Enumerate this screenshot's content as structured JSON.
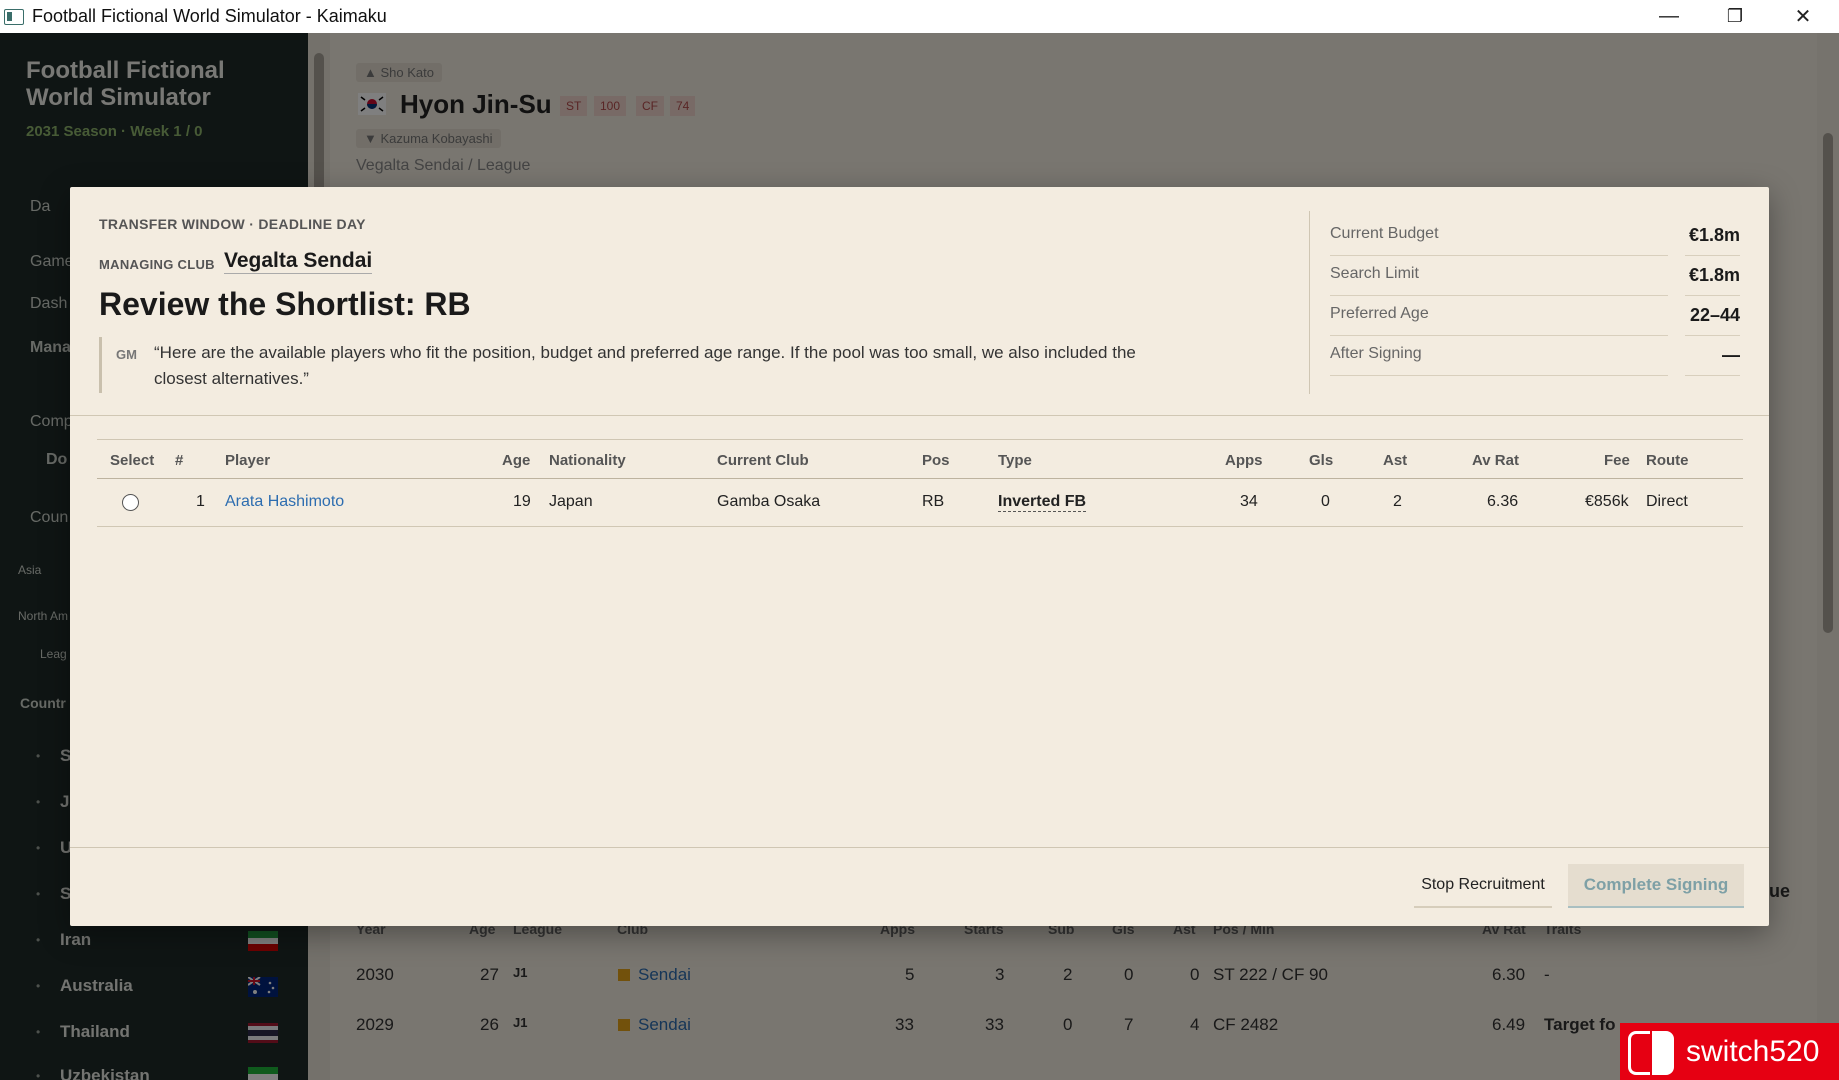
{
  "window": {
    "title": "Football Fictional World Simulator - Kaimaku",
    "minimize": "—",
    "restore": "❐",
    "close": "✕"
  },
  "sidebar": {
    "app_title": "Football Fictional World Simulator",
    "season": "2031 Season · Week 1 / 0",
    "items": [
      "Da",
      "Game",
      "Dash",
      "Mana",
      "Comp",
      "Do",
      "Coun",
      "Asia",
      "North Am",
      "Leag",
      "Countr"
    ],
    "countries": [
      "S",
      "J",
      "U",
      "S",
      "Iran",
      "Australia",
      "Thailand",
      "Uzbekistan"
    ]
  },
  "background": {
    "prev_player": "▲ Sho Kato",
    "player_name": "Hyon Jin-Su",
    "badges": [
      "ST",
      "100",
      "CF",
      "74"
    ],
    "next_player": "▼ Kazuma Kobayashi",
    "subtitle": "Vegalta Sendai / League",
    "right_fragment": "gue",
    "history_headers": [
      "Year",
      "Age",
      "League",
      "Club",
      "Apps",
      "Starts",
      "Sub",
      "Gls",
      "Ast",
      "Pos / Min",
      "Av Rat",
      "Traits"
    ],
    "history_rows": [
      {
        "year": "2030",
        "age": "27",
        "league": "J1",
        "club": "Sendai",
        "apps": "5",
        "starts": "3",
        "sub": "2",
        "gls": "0",
        "ast": "0",
        "pos": "ST 222 / CF 90",
        "avrat": "6.30",
        "traits": "-"
      },
      {
        "year": "2029",
        "age": "26",
        "league": "J1",
        "club": "Sendai",
        "apps": "33",
        "starts": "33",
        "sub": "0",
        "gls": "7",
        "ast": "4",
        "pos": "CF 2482",
        "avrat": "6.49",
        "traits": "Target fo"
      }
    ]
  },
  "modal": {
    "eyebrow": "TRANSFER WINDOW · DEADLINE DAY",
    "club_label": "MANAGING CLUB",
    "club_name": "Vegalta Sendai",
    "heading": "Review the Shortlist: RB",
    "quote_tag": "GM",
    "quote_text": "“Here are the available players who fit the position, budget and preferred age range. If the pool was too small, we also included the closest alternatives.”",
    "stats": [
      {
        "label": "Current Budget",
        "value": "€1.8m"
      },
      {
        "label": "Search Limit",
        "value": "€1.8m"
      },
      {
        "label": "Preferred Age",
        "value": "22–44"
      },
      {
        "label": "After Signing",
        "value": "—"
      }
    ],
    "table": {
      "headers": {
        "select": "Select",
        "num": "#",
        "player": "Player",
        "age": "Age",
        "nationality": "Nationality",
        "club": "Current Club",
        "pos": "Pos",
        "type": "Type",
        "apps": "Apps",
        "gls": "Gls",
        "ast": "Ast",
        "avrat": "Av Rat",
        "fee": "Fee",
        "route": "Route"
      },
      "rows": [
        {
          "num": "1",
          "player": "Arata Hashimoto",
          "age": "19",
          "nationality": "Japan",
          "club": "Gamba Osaka",
          "pos": "RB",
          "type": "Inverted FB",
          "apps": "34",
          "gls": "0",
          "ast": "2",
          "avrat": "6.36",
          "fee": "€856k",
          "route": "Direct"
        }
      ]
    },
    "buttons": {
      "stop": "Stop Recruitment",
      "complete": "Complete Signing"
    }
  },
  "watermark": {
    "text": "switch520"
  },
  "colors": {
    "modal_bg": "#f3ece0",
    "sidebar_bg": "#1f2a28",
    "link": "#2d6db0",
    "complete_text": "#7ea0a6",
    "watermark_bg": "#e60012"
  }
}
